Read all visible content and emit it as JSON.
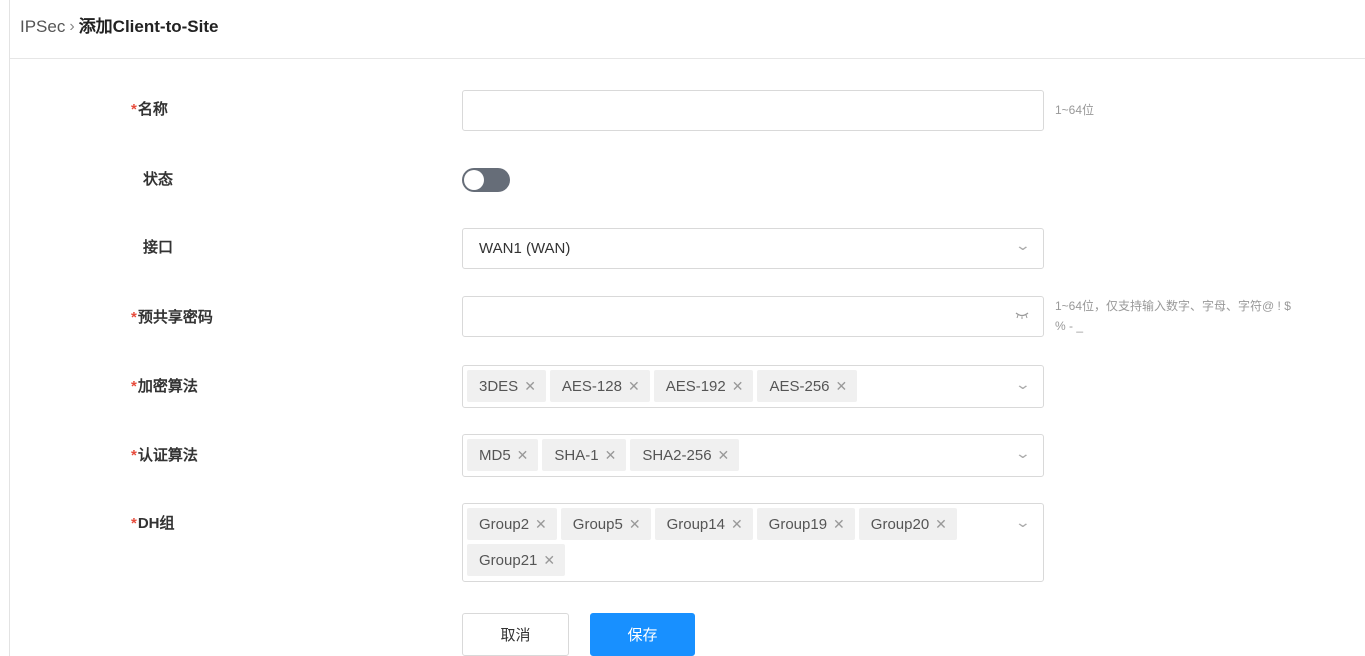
{
  "breadcrumb": {
    "root": "IPSec",
    "separator": "›",
    "current": "添加Client-to-Site"
  },
  "form": {
    "name": {
      "required_mark": "*",
      "label": "名称",
      "value": "",
      "hint": "1~64位"
    },
    "status": {
      "label": "状态",
      "enabled": false
    },
    "interface": {
      "label": "接口",
      "value": "WAN1 (WAN)"
    },
    "psk": {
      "required_mark": "*",
      "label": "预共享密码",
      "value": "",
      "hint_line1": "1~64位，仅支持输入数字、字母、字符@ ! $",
      "hint_line2": "% - _"
    },
    "encryption": {
      "required_mark": "*",
      "label": "加密算法",
      "tags": [
        "3DES",
        "AES-128",
        "AES-192",
        "AES-256"
      ]
    },
    "auth": {
      "required_mark": "*",
      "label": "认证算法",
      "tags": [
        "MD5",
        "SHA-1",
        "SHA2-256"
      ]
    },
    "dh": {
      "required_mark": "*",
      "label": "DH组",
      "tags": [
        "Group2",
        "Group5",
        "Group14",
        "Group19",
        "Group20",
        "Group21"
      ]
    }
  },
  "icons": {
    "chevron": "chevron-down-icon",
    "eye": "eye-closed-icon",
    "tag_close": "close-icon"
  },
  "colors": {
    "primary": "#1890ff",
    "required": "#e74c3c",
    "toggle_off": "#666d78"
  },
  "buttons": {
    "cancel": "取消",
    "save": "保存"
  }
}
